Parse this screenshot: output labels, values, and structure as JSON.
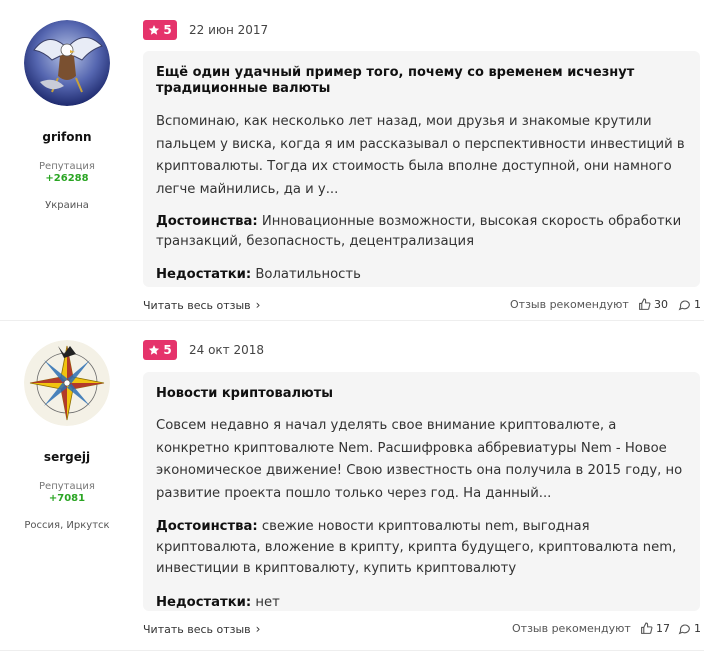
{
  "reviews": [
    {
      "author": {
        "name": "grifonn",
        "reputation_label": "Репутация",
        "reputation": "+26288",
        "location": "Украина",
        "avatar_icon": "eagle-avatar"
      },
      "rating": "5",
      "date": "22 июн 2017",
      "title": "Ещё один удачный пример того, почему со временем исчезнут традиционные валюты",
      "text": "Вспоминаю, как несколько лет назад, мои друзья и знакомые крутили пальцем у виска, когда я им рассказывал о перспективности инвестиций в криптовалюты. Тогда их стоимость была вполне доступной, они намного легче майнились, да и у...",
      "pros_label": "Достоинства:",
      "pros": "Инновационные возможности, высокая скорость обработки транзакций, безопасность, децентрализация",
      "cons_label": "Недостатки:",
      "cons": "Волатильность",
      "read_more": "Читать весь отзыв",
      "recommend_label": "Отзыв рекомендуют",
      "likes": "30",
      "comments": "1"
    },
    {
      "author": {
        "name": "sergejj",
        "reputation_label": "Репутация",
        "reputation": "+7081",
        "location": "Россия, Иркутск",
        "avatar_icon": "compass-rose-avatar"
      },
      "rating": "5",
      "date": "24 окт 2018",
      "title": "Новости криптовалюты",
      "text": "Совсем недавно я начал уделять свое внимание криптовалюте, а конкретно криптовалюте Nem. Расшифровка аббревиатуры Nem - Новое экономическое движение! Свою известность она получила в 2015 году, но развитие проекта пошло только через год. На данный...",
      "pros_label": "Достоинства:",
      "pros": "свежие новости криптовалюты nem, выгодная криптовалюта, вложение в крипту, крипта будущего, криптовалюта nem, инвестиции в криптовалюту, купить криптовалюту",
      "cons_label": "Недостатки:",
      "cons": "нет",
      "read_more": "Читать весь отзыв",
      "recommend_label": "Отзыв рекомендуют",
      "likes": "17",
      "comments": "1"
    }
  ],
  "colors": {
    "rating_badge": "#e5336b",
    "reputation": "#2aa523",
    "card_bg": "#f5f5f5"
  }
}
